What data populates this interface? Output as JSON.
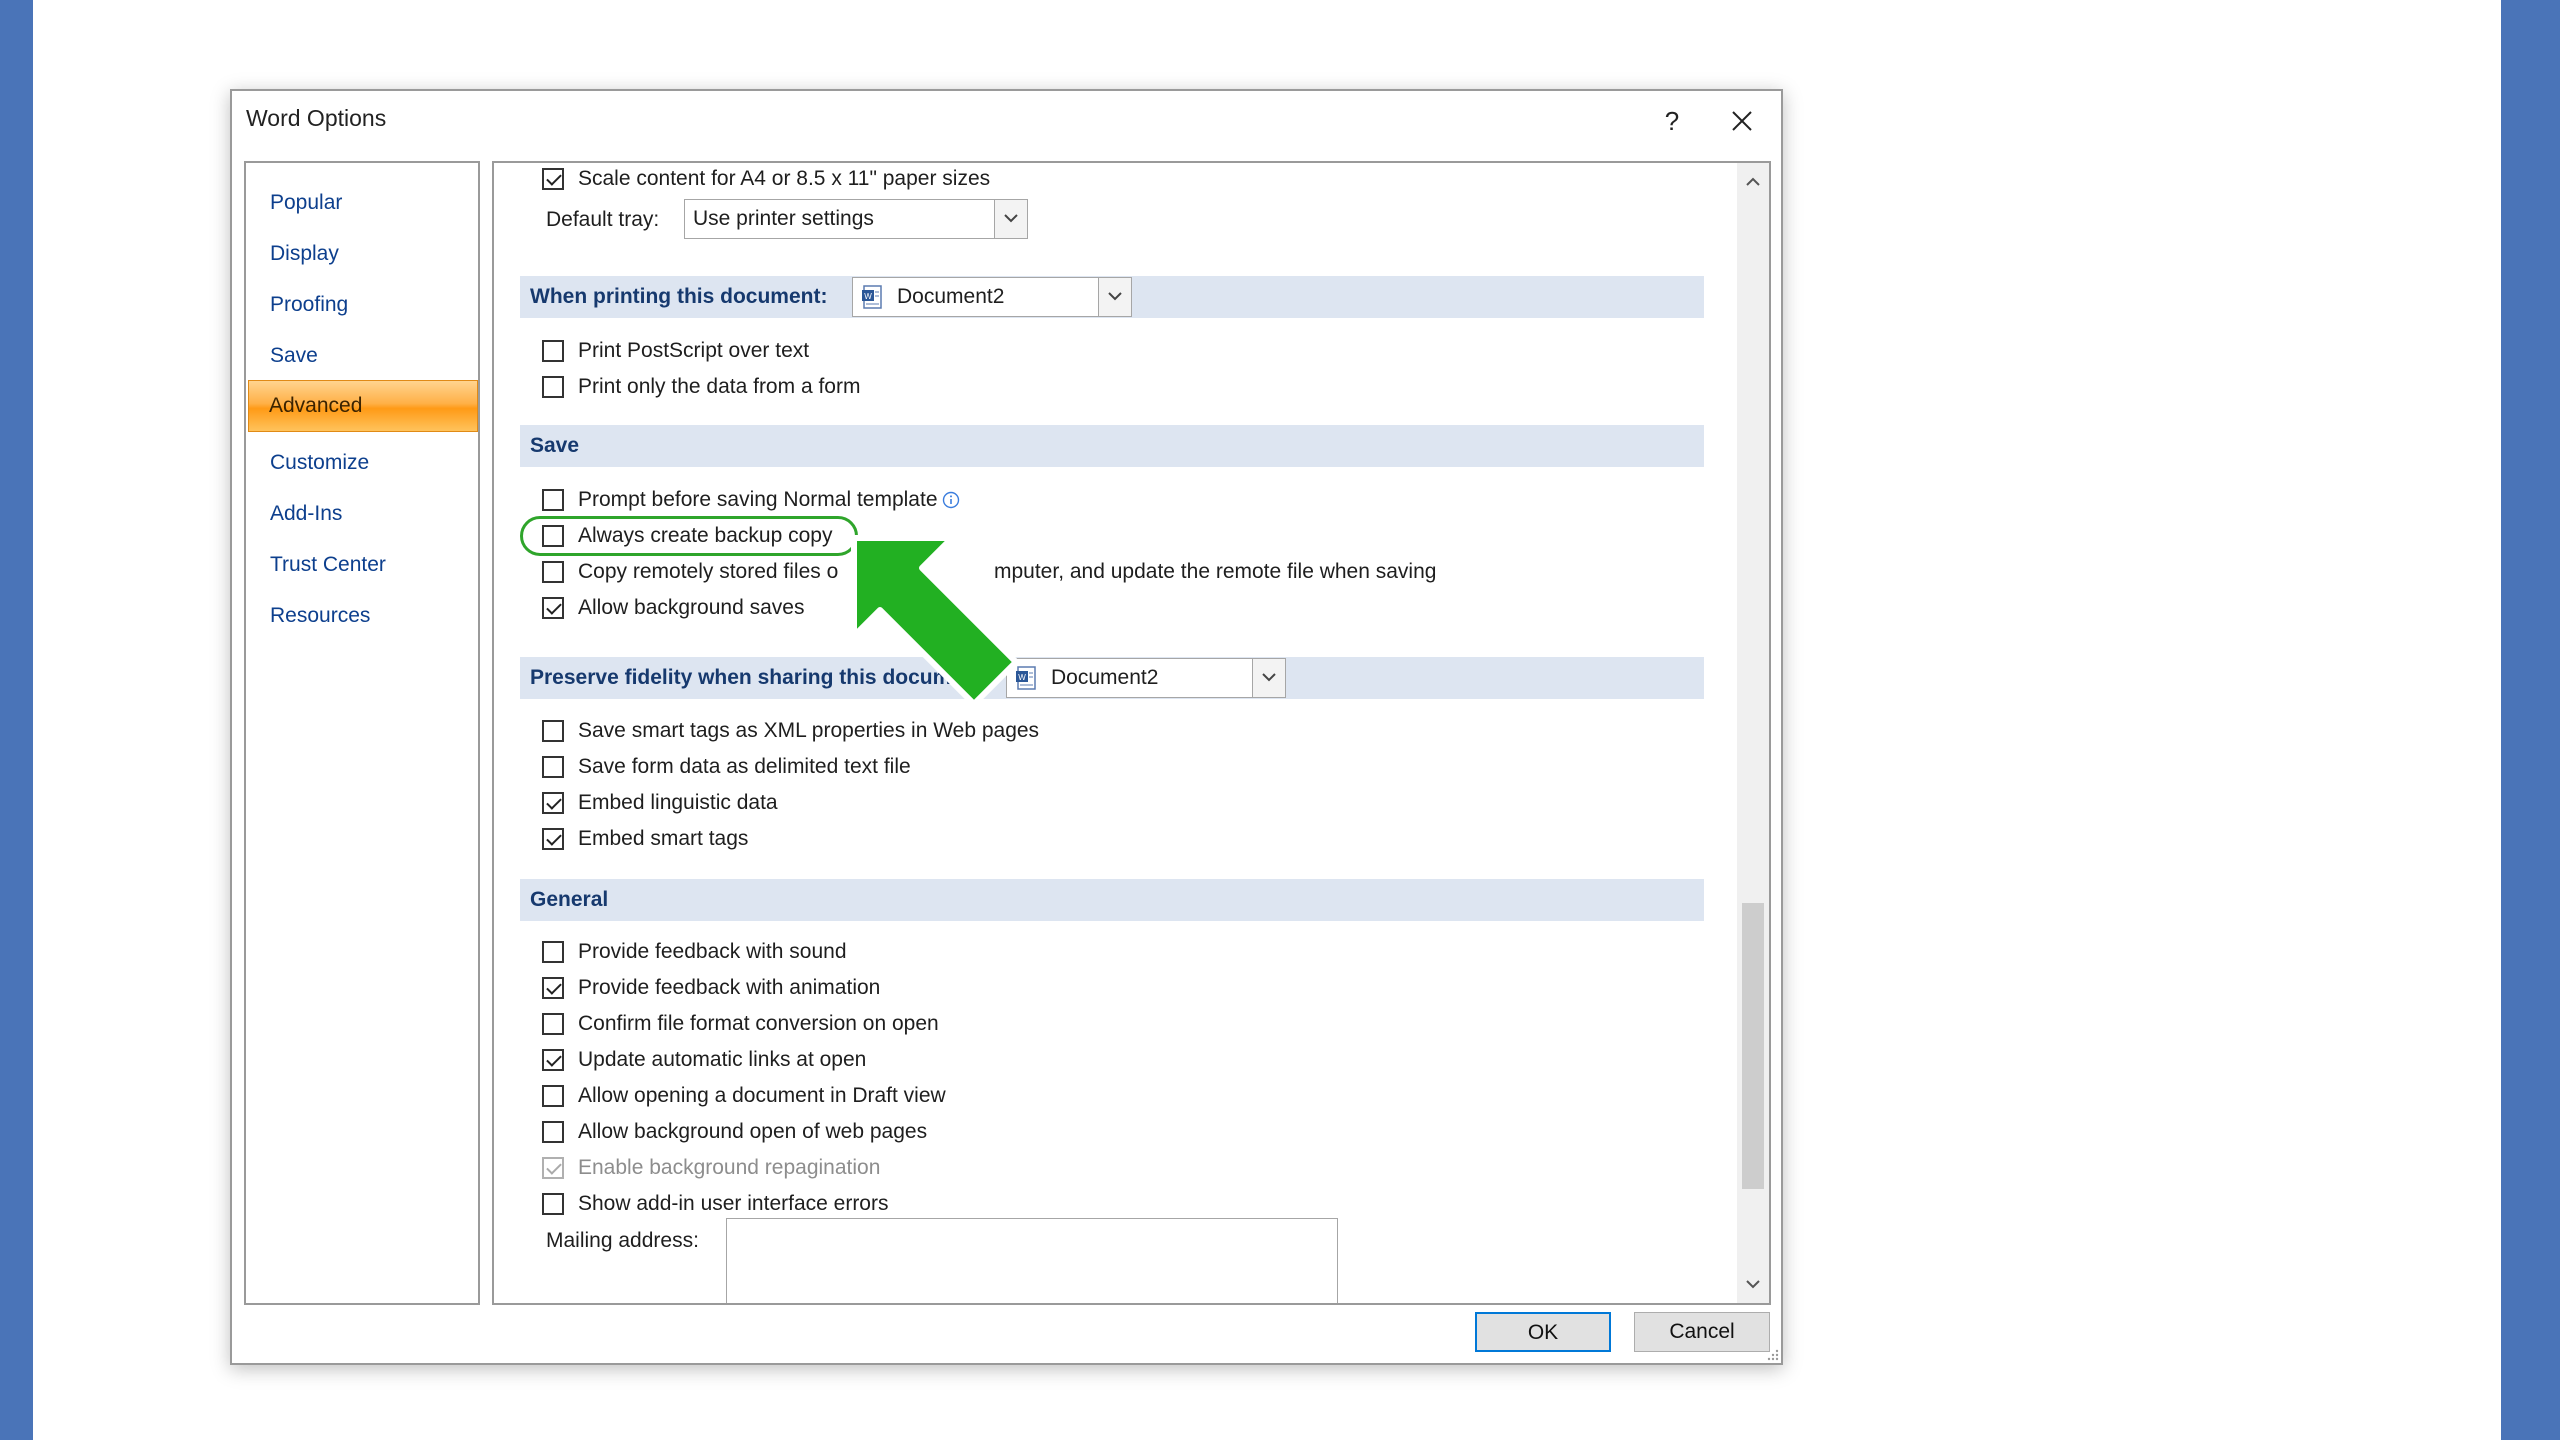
{
  "dialog": {
    "title": "Word Options",
    "help_label": "?",
    "ok_label": "OK",
    "cancel_label": "Cancel"
  },
  "nav": {
    "items": [
      {
        "label": "Popular"
      },
      {
        "label": "Display"
      },
      {
        "label": "Proofing"
      },
      {
        "label": "Save"
      },
      {
        "label": "Advanced",
        "active": true
      },
      {
        "label": "Customize"
      },
      {
        "label": "Add-Ins"
      },
      {
        "label": "Trust Center"
      },
      {
        "label": "Resources"
      }
    ]
  },
  "print": {
    "scale_content": {
      "label": "Scale content for A4 or 8.5 x 11\" paper sizes",
      "checked": true
    },
    "default_tray_label": "Default tray:",
    "default_tray_value": "Use printer settings"
  },
  "when_printing": {
    "header": "When printing this document:",
    "document": "Document2",
    "options": [
      {
        "label": "Print PostScript over text",
        "checked": false
      },
      {
        "label": "Print only the data from a form",
        "checked": false
      }
    ]
  },
  "save": {
    "header": "Save",
    "options": [
      {
        "label": "Prompt before saving Normal template",
        "checked": false
      },
      {
        "label": "Always create backup copy",
        "checked": false
      },
      {
        "label": "Copy remotely stored files o",
        "label_tail": "mputer, and update the remote file when saving",
        "checked": false
      },
      {
        "label": "Allow background saves",
        "checked": true
      }
    ]
  },
  "preserve": {
    "header": "Preserve fidelity when sharing this docum",
    "document": "Document2",
    "options": [
      {
        "label": "Save smart tags as XML properties in Web pages",
        "checked": false
      },
      {
        "label": "Save form data as delimited text file",
        "checked": false
      },
      {
        "label": "Embed linguistic data",
        "checked": true
      },
      {
        "label": "Embed smart tags",
        "checked": true
      }
    ]
  },
  "general": {
    "header": "General",
    "options": [
      {
        "label": "Provide feedback with sound",
        "checked": false
      },
      {
        "label": "Provide feedback with animation",
        "checked": true
      },
      {
        "label": "Confirm file format conversion on open",
        "checked": false
      },
      {
        "label": "Update automatic links at open",
        "checked": true
      },
      {
        "label": "Allow opening a document in Draft view",
        "checked": false
      },
      {
        "label": "Allow background open of web pages",
        "checked": false
      },
      {
        "label": "Enable background repagination",
        "checked": true,
        "disabled": true
      },
      {
        "label": "Show add-in user interface errors",
        "checked": false
      }
    ],
    "mailing_address_label": "Mailing address:",
    "mailing_address_value": ""
  },
  "colors": {
    "accent_arrow": "#22b022",
    "highlight_ring": "#2fa52b",
    "section_bg": "#dde5f1",
    "active_nav": "#ffa531"
  }
}
